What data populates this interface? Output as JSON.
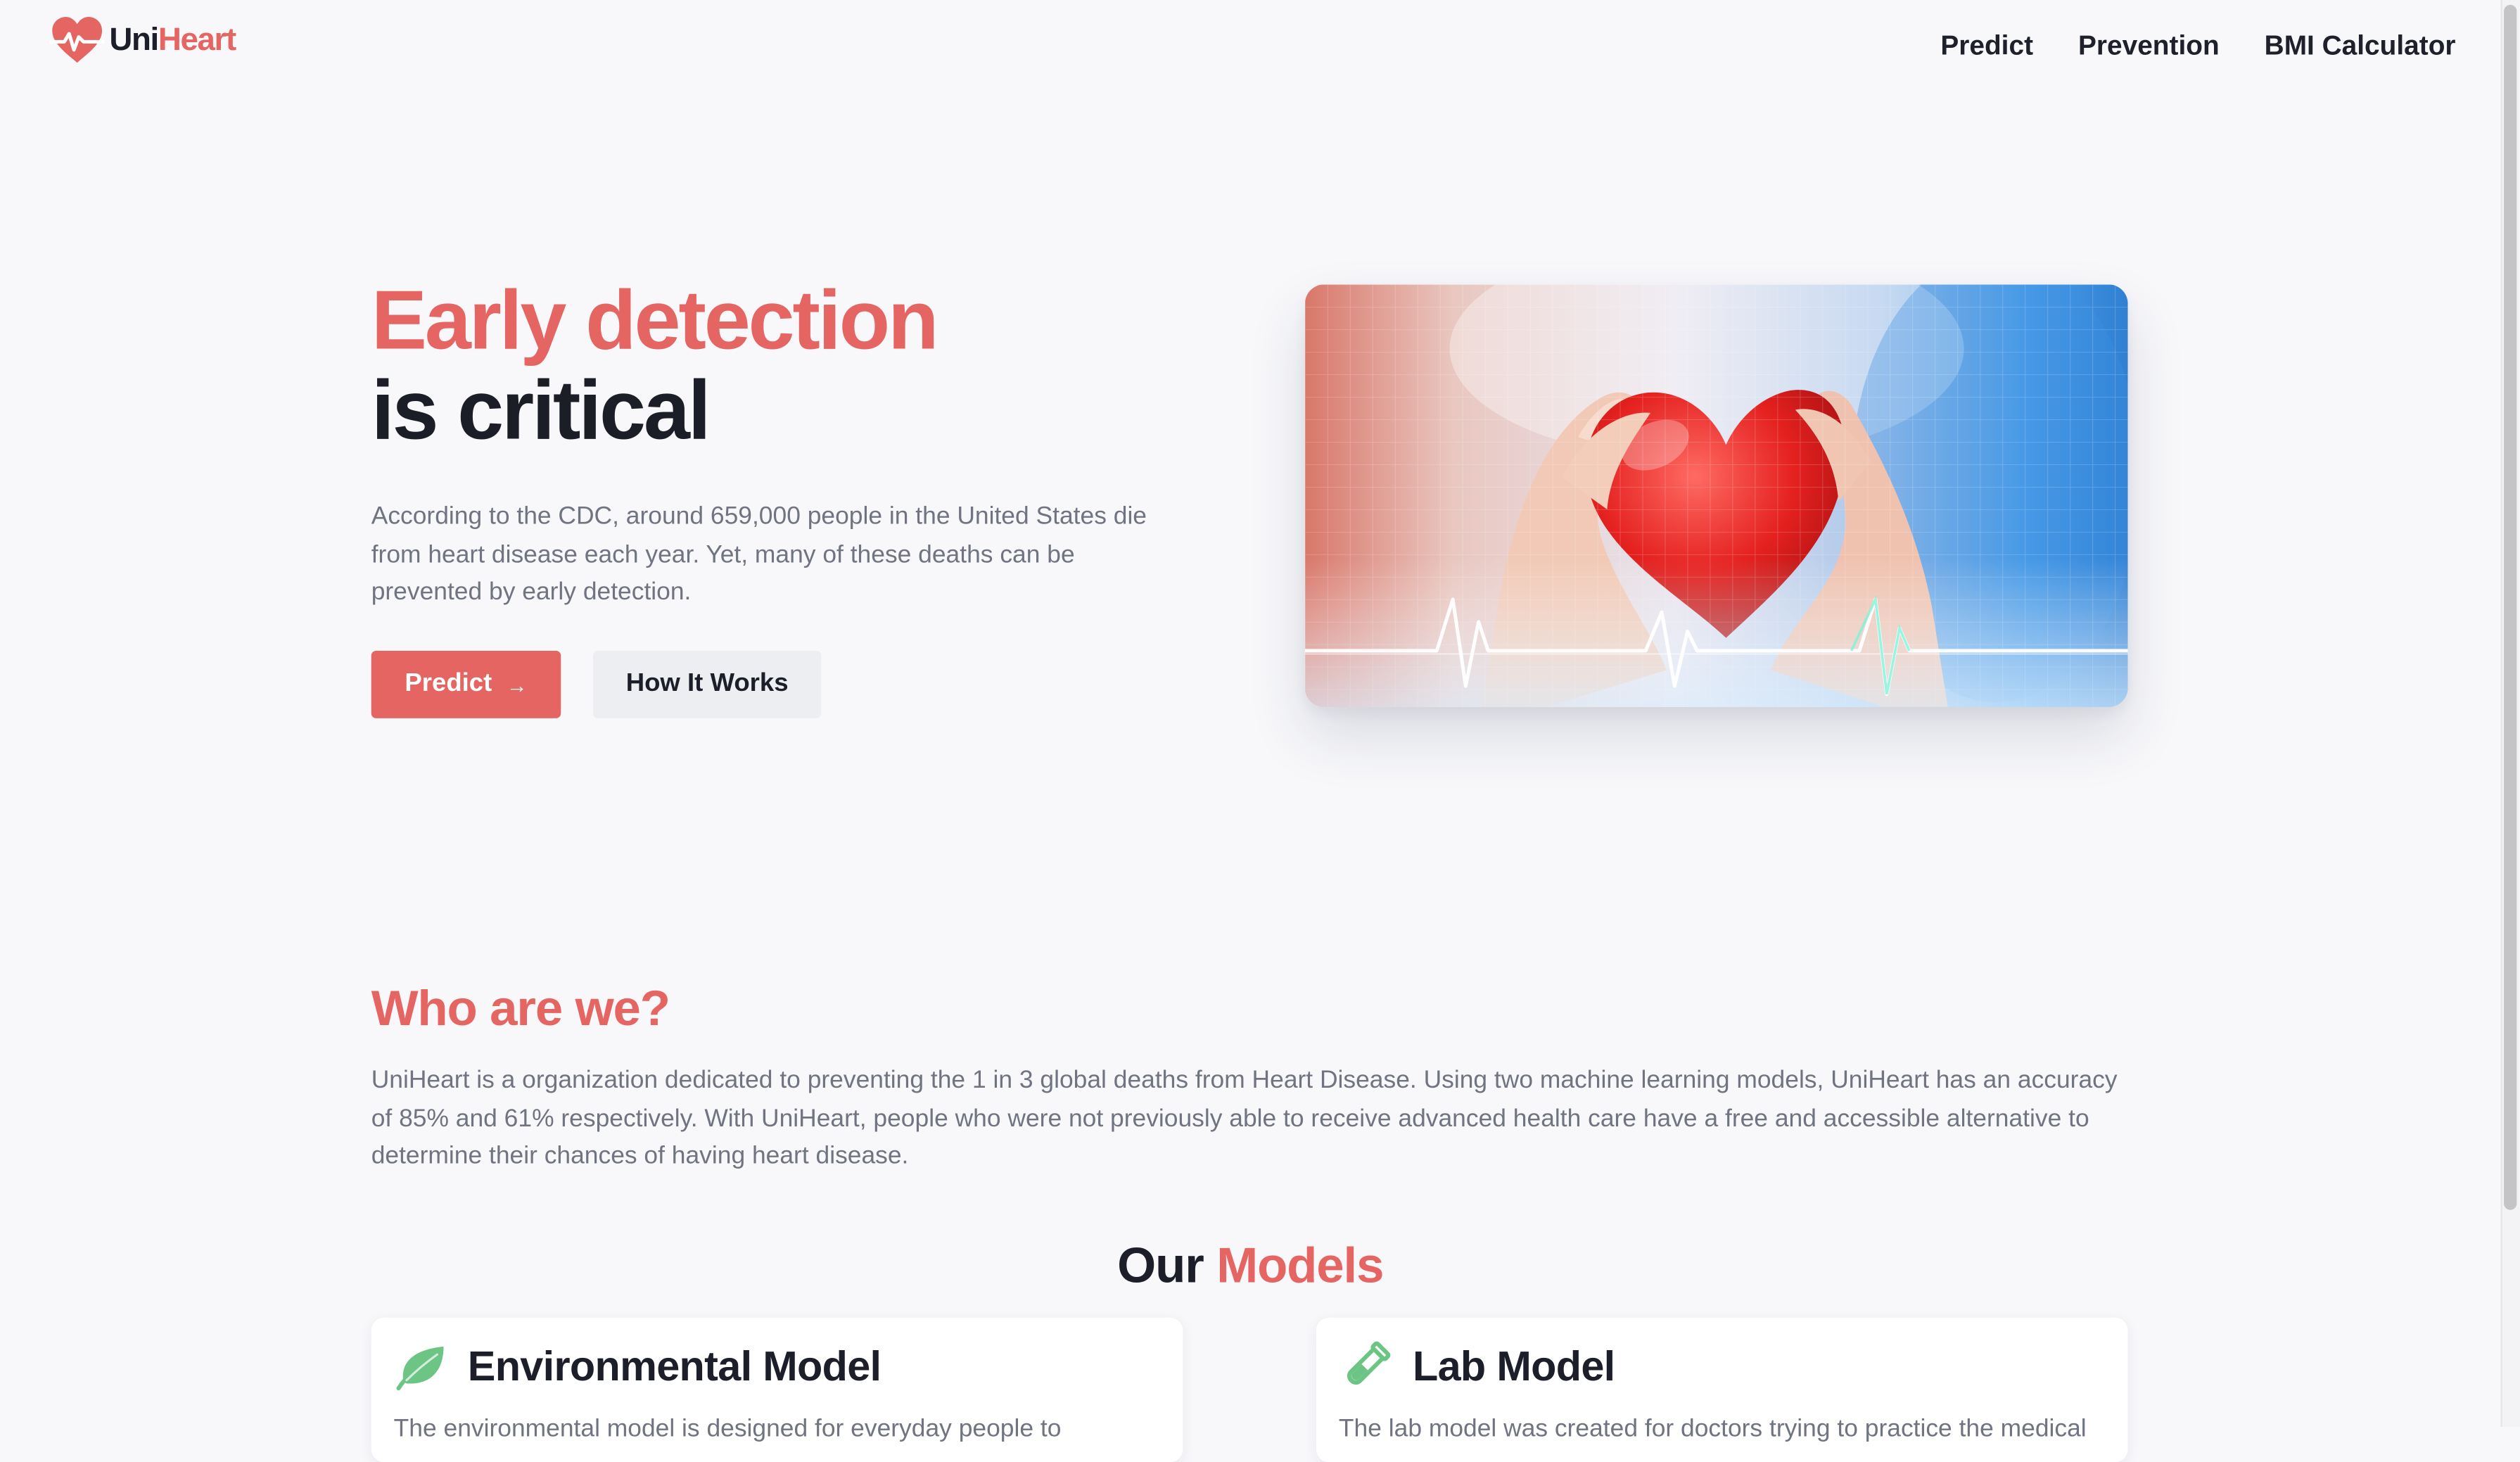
{
  "brand": {
    "name_part1": "Uni",
    "name_part2": "Heart",
    "colors": {
      "accent": "#e56562",
      "dark": "#1c1f29",
      "muted": "#6f7480",
      "background": "#f8f8fb",
      "secondary_button": "#eceef1",
      "icon_green": "#6cc485"
    }
  },
  "nav": {
    "items": [
      {
        "label": "Predict"
      },
      {
        "label": "Prevention"
      },
      {
        "label": "BMI Calculator"
      }
    ]
  },
  "hero": {
    "title_line1": "Early detection",
    "title_line2": "is critical",
    "description": "According to the CDC, around 659,000 people in the United States die from heart disease each year. Yet, many of these deaths can be prevented by early detection.",
    "primary_button": "Predict",
    "primary_button_icon": "→",
    "secondary_button": "How It Works",
    "image_alt": "Hands holding a red heart"
  },
  "about": {
    "title": "Who are we?",
    "body": "UniHeart is a organization dedicated to preventing the 1 in 3 global deaths from Heart Disease. Using two machine learning models, UniHeart has an accuracy of 85% and 61% respectively. With UniHeart, people who were not previously able to receive advanced health care have a free and accessible alternative to determine their chances of having heart disease."
  },
  "models": {
    "title_part1": "Our",
    "title_part2": "Models",
    "cards": [
      {
        "title": "Environmental Model",
        "icon": "leaf-icon",
        "text": "The environmental model is designed for everyday people to"
      },
      {
        "title": "Lab Model",
        "icon": "test-tube-icon",
        "text": "The lab model was created for doctors trying to practice the medical"
      }
    ]
  }
}
